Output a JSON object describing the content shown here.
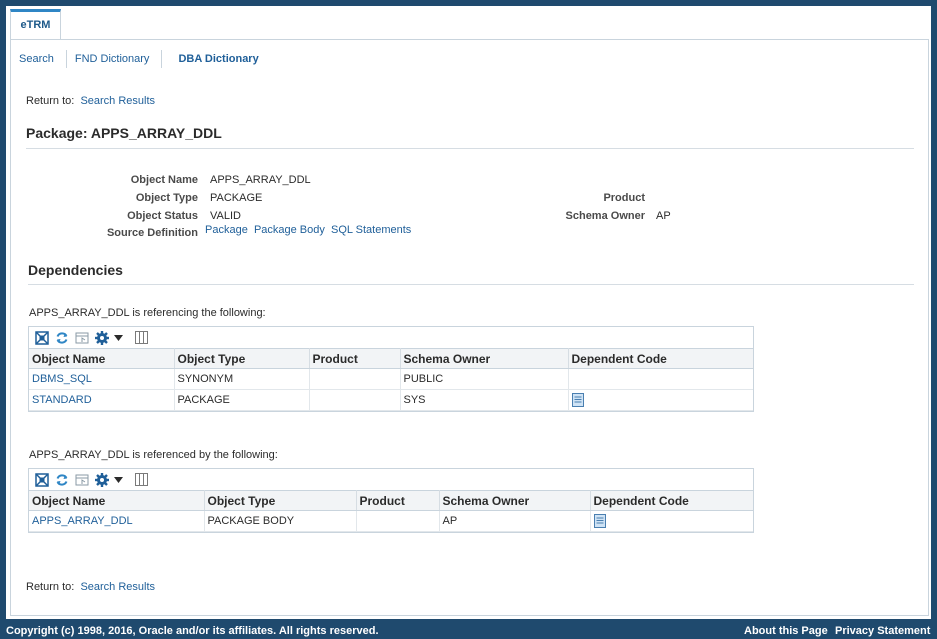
{
  "tab": {
    "label": "eTRM"
  },
  "subnav": {
    "search": "Search",
    "fnd": "FND Dictionary",
    "dba": "DBA Dictionary"
  },
  "return_to": {
    "label": "Return to:",
    "link": "Search Results"
  },
  "page_title": "Package: APPS_ARRAY_DDL",
  "details": {
    "object_name_label": "Object Name",
    "object_name": "APPS_ARRAY_DDL",
    "object_type_label": "Object Type",
    "object_type": "PACKAGE",
    "object_status_label": "Object Status",
    "object_status": "VALID",
    "source_def_label": "Source Definition",
    "source_links": [
      "Package",
      "Package Body",
      "SQL Statements"
    ],
    "product_label": "Product",
    "product": "",
    "schema_owner_label": "Schema Owner",
    "schema_owner": "AP"
  },
  "dependencies": {
    "title": "Dependencies",
    "referencing_caption": "APPS_ARRAY_DDL is referencing the following:",
    "referenced_caption": "APPS_ARRAY_DDL is referenced by the following:",
    "columns": [
      "Object Name",
      "Object Type",
      "Product",
      "Schema Owner",
      "Dependent Code"
    ],
    "referencing_rows": [
      {
        "name": "DBMS_SQL",
        "type": "SYNONYM",
        "product": "",
        "owner": "PUBLIC",
        "code": false
      },
      {
        "name": "STANDARD",
        "type": "PACKAGE",
        "product": "",
        "owner": "SYS",
        "code": true
      }
    ],
    "referenced_rows": [
      {
        "name": "APPS_ARRAY_DDL",
        "type": "PACKAGE BODY",
        "product": "",
        "owner": "AP",
        "code": true
      }
    ]
  },
  "footer": {
    "copyright": "Copyright (c) 1998, 2016, Oracle and/or its affiliates. All rights reserved.",
    "about": "About this Page",
    "privacy": "Privacy Statement"
  },
  "colors": {
    "brand_bar": "#1f4a6e",
    "link": "#1f5f99",
    "tab_accent": "#2f86c5"
  }
}
